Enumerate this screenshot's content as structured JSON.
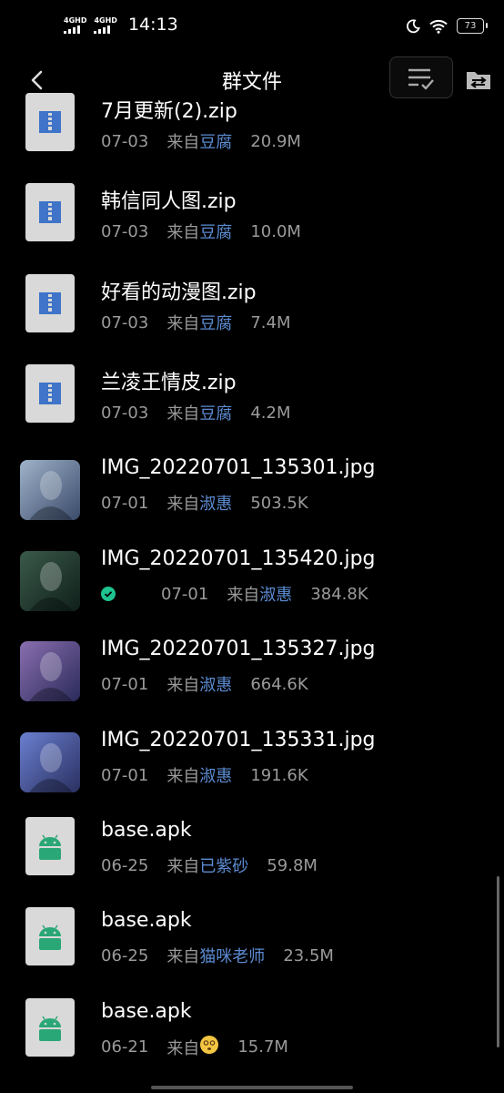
{
  "status": {
    "net1": "4GHD",
    "net2": "4GHD",
    "time": "14:13",
    "battery": "73",
    "icons": [
      "signal-icon",
      "moon-icon",
      "wifi-icon",
      "battery-icon"
    ]
  },
  "nav": {
    "title": "群文件",
    "icons": [
      "back-icon",
      "sort-list-icon",
      "folder-icon"
    ]
  },
  "files": [
    {
      "name": "7月更新(2).zip",
      "date": "07-03",
      "from": "来自",
      "sender": "豆腐",
      "size": "20.9M",
      "kind": "zip"
    },
    {
      "name": "韩信同人图.zip",
      "date": "07-03",
      "from": "来自",
      "sender": "豆腐",
      "size": "10.0M",
      "kind": "zip"
    },
    {
      "name": "好看的动漫图.zip",
      "date": "07-03",
      "from": "来自",
      "sender": "豆腐",
      "size": "7.4M",
      "kind": "zip"
    },
    {
      "name": "兰凌王情皮.zip",
      "date": "07-03",
      "from": "来自",
      "sender": "豆腐",
      "size": "4.2M",
      "kind": "zip"
    },
    {
      "name": "IMG_20220701_135301.jpg",
      "date": "07-01",
      "from": "来自",
      "sender": "淑惠",
      "size": "503.5K",
      "kind": "image",
      "colors": [
        "#9fb3c9",
        "#3a4a6a"
      ]
    },
    {
      "name": "IMG_20220701_135420.jpg",
      "date": "07-01",
      "from": "来自",
      "sender": "淑惠",
      "size": "384.8K",
      "kind": "image",
      "colors": [
        "#3a5a4a",
        "#0f1f1a"
      ],
      "downloaded": true
    },
    {
      "name": "IMG_20220701_135327.jpg",
      "date": "07-01",
      "from": "来自",
      "sender": "淑惠",
      "size": "664.6K",
      "kind": "image",
      "colors": [
        "#8a6fb0",
        "#2a2a5a"
      ]
    },
    {
      "name": "IMG_20220701_135331.jpg",
      "date": "07-01",
      "from": "来自",
      "sender": "淑惠",
      "size": "191.6K",
      "kind": "image",
      "colors": [
        "#6a7fd0",
        "#2a3060"
      ]
    },
    {
      "name": "base.apk",
      "date": "06-25",
      "from": "来自",
      "sender": "已紫砂",
      "size": "59.8M",
      "kind": "apk"
    },
    {
      "name": "base.apk",
      "date": "06-25",
      "from": "来自",
      "sender": "猫咪老师",
      "size": "23.5M",
      "kind": "apk"
    },
    {
      "name": "base.apk",
      "date": "06-21",
      "from": "来自",
      "sender": "",
      "size": "15.7M",
      "kind": "apk",
      "sender_emoji": "dizzy-face-emoji-icon"
    }
  ],
  "colors": {
    "accent": "#5b8bd1",
    "zip": "#3f74c8",
    "apk": "#2aa776",
    "check": "#1fc38f"
  }
}
